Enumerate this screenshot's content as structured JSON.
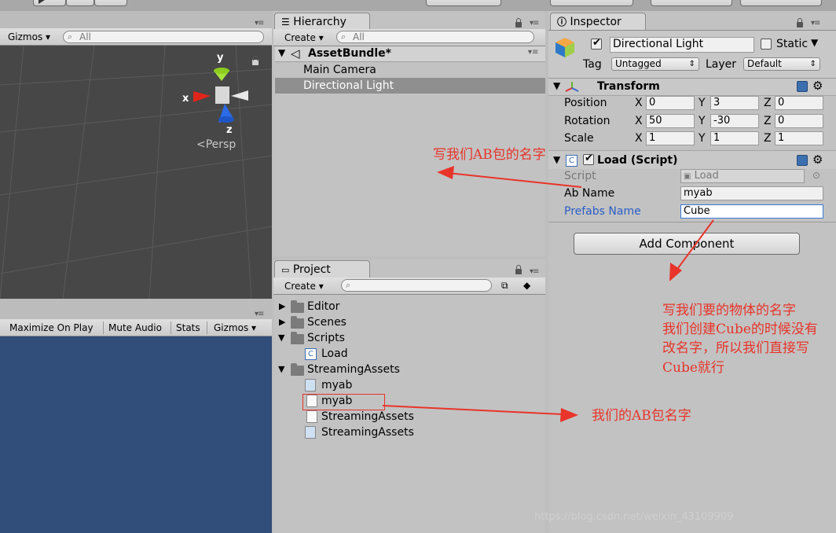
{
  "scene": {
    "gizmos_label": "Gizmos",
    "search_placeholder": "All",
    "gizmo_y": "y",
    "gizmo_x": "x",
    "gizmo_z": "z",
    "persp_label": "Persp"
  },
  "game": {
    "maximize_label": "Maximize On Play",
    "mute_label": "Mute Audio",
    "stats_label": "Stats",
    "gizmos_label": "Gizmos"
  },
  "hierarchy": {
    "tab_label": "Hierarchy",
    "create_label": "Create",
    "search_placeholder": "All",
    "scene_name": "AssetBundle*",
    "items": [
      "Main Camera",
      "Directional Light"
    ]
  },
  "project": {
    "tab_label": "Project",
    "create_label": "Create",
    "tree": [
      {
        "label": "Editor"
      },
      {
        "label": "Scenes"
      },
      {
        "label": "Scripts"
      },
      {
        "label": "Load"
      },
      {
        "label": "StreamingAssets"
      },
      {
        "label": "myab"
      },
      {
        "label": "myab"
      },
      {
        "label": "StreamingAssets"
      },
      {
        "label": "StreamingAssets"
      }
    ]
  },
  "inspector": {
    "tab_label": "Inspector",
    "object_name": "Directional Light",
    "static_label": "Static",
    "tag_label": "Tag",
    "tag_value": "Untagged",
    "layer_label": "Layer",
    "layer_value": "Default",
    "transform": {
      "title": "Transform",
      "position_label": "Position",
      "rotation_label": "Rotation",
      "scale_label": "Scale",
      "x": "X",
      "y": "Y",
      "z": "Z",
      "position": [
        "0",
        "3",
        "0"
      ],
      "rotation": [
        "50",
        "-30",
        "0"
      ],
      "scale": [
        "1",
        "1",
        "1"
      ]
    },
    "script_component": {
      "title": "Load (Script)",
      "script_label": "Script",
      "script_value": "Load",
      "ab_name_label": "Ab Name",
      "ab_name_value": "myab",
      "prefabs_name_label": "Prefabs Name",
      "prefabs_name_value": "Cube"
    },
    "add_component_label": "Add Component"
  },
  "annotations": {
    "ab_name_note": "写我们AB包的名字",
    "object_name_note": [
      "写我们要的物体的名字",
      "我们创建Cube的时候没有",
      "改名字，所以我们直接写",
      "Cube就行"
    ],
    "bundle_note": "我们的AB包名字"
  },
  "watermark": "https://blog.csdn.net/weixin_43109909",
  "colors": {
    "scene_bg": "#474747",
    "game_bg": "#314d79",
    "selection": "#8f8f8f",
    "annotation": "#e8342a",
    "prefabs_label": "#2b5ec7"
  }
}
